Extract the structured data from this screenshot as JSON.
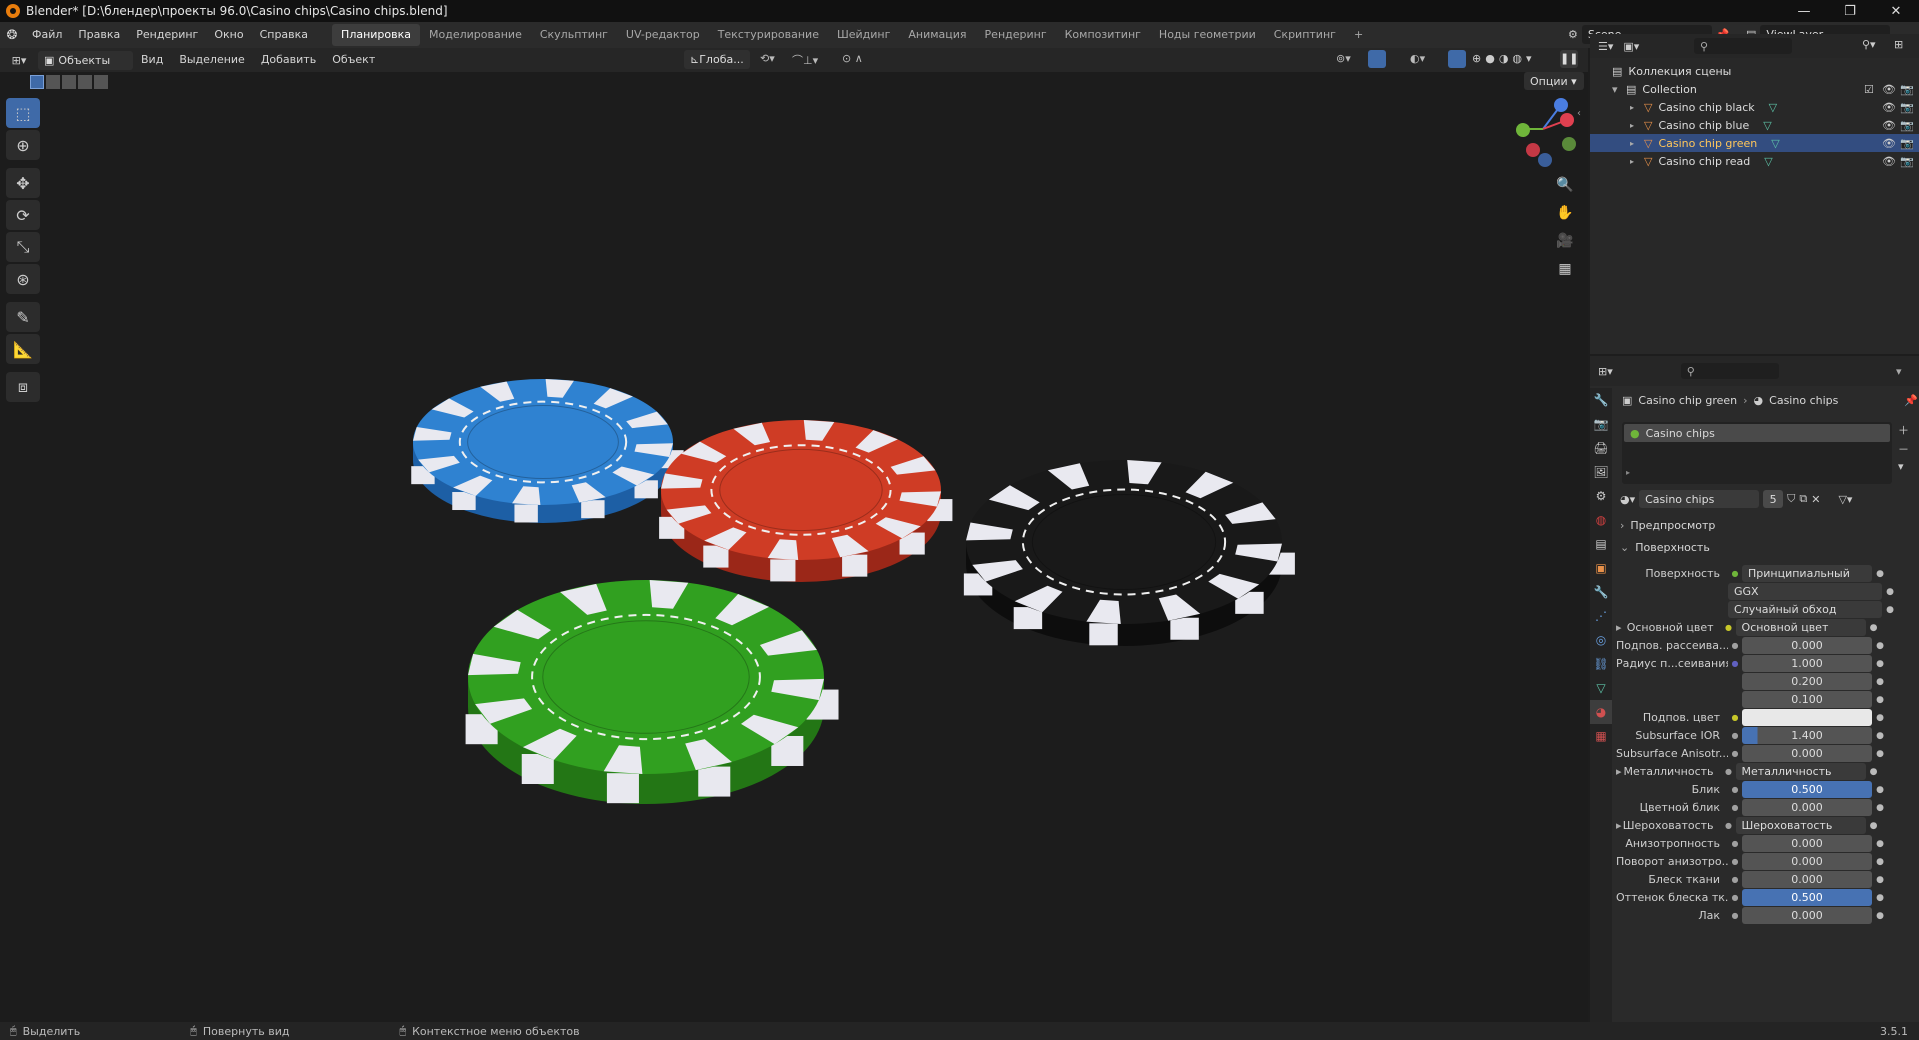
{
  "window": {
    "title": "Blender* [D:\\блендер\\проекты 96.0\\Casino chips\\Casino chips.blend]"
  },
  "menus": [
    "Файл",
    "Правка",
    "Рендеринг",
    "Окно",
    "Справка"
  ],
  "workspaces": [
    "Планировка",
    "Моделирование",
    "Скульптинг",
    "UV-редактор",
    "Текстурирование",
    "Шейдинг",
    "Анимация",
    "Рендеринг",
    "Композитинг",
    "Ноды геометрии",
    "Скриптинг"
  ],
  "scene": "Scene",
  "view_layer": "ViewLayer",
  "viewport": {
    "mode": "Объекты",
    "menu": [
      "Вид",
      "Выделение",
      "Добавить",
      "Объект"
    ],
    "orientation": "Глоба...",
    "options": "Опции"
  },
  "outliner": {
    "root": "Коллекция сцены",
    "collection": "Collection",
    "items": [
      "Casino chip black",
      "Casino chip blue",
      "Casino chip green",
      "Casino chip read"
    ],
    "selected": 2
  },
  "props": {
    "breadcrumb_obj": "Casino chip green",
    "breadcrumb_mat": "Casino chips",
    "slot": "Casino chips",
    "material": "Casino chips",
    "users": "5",
    "preview": "Предпросмотр",
    "surface_panel": "Поверхность",
    "rows": [
      {
        "label": "Поверхность",
        "value": "Принципиальный BSDF",
        "kind": "dark",
        "dot": "green"
      },
      {
        "label": "",
        "value": "GGX",
        "kind": "select"
      },
      {
        "label": "",
        "value": "Случайный обход",
        "kind": "select"
      },
      {
        "label": "Основной цвет",
        "value": "Основной цвет",
        "kind": "dark",
        "dot": "yellow",
        "expand": true
      },
      {
        "label": "Подпов. рассеива...",
        "value": "0.000",
        "kind": "num",
        "dot": "grey"
      },
      {
        "label": "Радиус п...сеивания",
        "value": "1.000",
        "kind": "num",
        "dot": "purple"
      },
      {
        "label": "",
        "value": "0.200",
        "kind": "num"
      },
      {
        "label": "",
        "value": "0.100",
        "kind": "num"
      },
      {
        "label": "Подпов. цвет",
        "value": "",
        "kind": "color",
        "dot": "yellow"
      },
      {
        "label": "Subsurface IOR",
        "value": "1.400",
        "kind": "num",
        "dot": "grey",
        "fill": 0.12
      },
      {
        "label": "Subsurface Anisotr...",
        "value": "0.000",
        "kind": "num",
        "dot": "grey"
      },
      {
        "label": "Металличность",
        "value": "Металличность",
        "kind": "dark",
        "dot": "grey",
        "expand": true
      },
      {
        "label": "Блик",
        "value": "0.500",
        "kind": "blue",
        "dot": "grey"
      },
      {
        "label": "Цветной блик",
        "value": "0.000",
        "kind": "num",
        "dot": "grey"
      },
      {
        "label": "Шероховатость",
        "value": "Шероховатость",
        "kind": "dark",
        "dot": "grey",
        "expand": true
      },
      {
        "label": "Анизотропность",
        "value": "0.000",
        "kind": "num",
        "dot": "grey"
      },
      {
        "label": "Поворот анизотро...",
        "value": "0.000",
        "kind": "num",
        "dot": "grey"
      },
      {
        "label": "Блеск ткани",
        "value": "0.000",
        "kind": "num",
        "dot": "grey"
      },
      {
        "label": "Оттенок блеска тк...",
        "value": "0.500",
        "kind": "blue",
        "dot": "grey"
      },
      {
        "label": "Лак",
        "value": "0.000",
        "kind": "num",
        "dot": "grey"
      }
    ]
  },
  "status": {
    "select": "Выделить",
    "rotate": "Повернуть вид",
    "context": "Контекстное меню объектов",
    "version": "3.5.1"
  },
  "chips": [
    {
      "name": "blue",
      "color": "#2f82d1",
      "edge": "#1d5fa5"
    },
    {
      "name": "red",
      "color": "#cf3c25",
      "edge": "#9b2718"
    },
    {
      "name": "black",
      "color": "#191919",
      "edge": "#0d0d0d"
    },
    {
      "name": "green",
      "color": "#31a020",
      "edge": "#237615"
    }
  ]
}
